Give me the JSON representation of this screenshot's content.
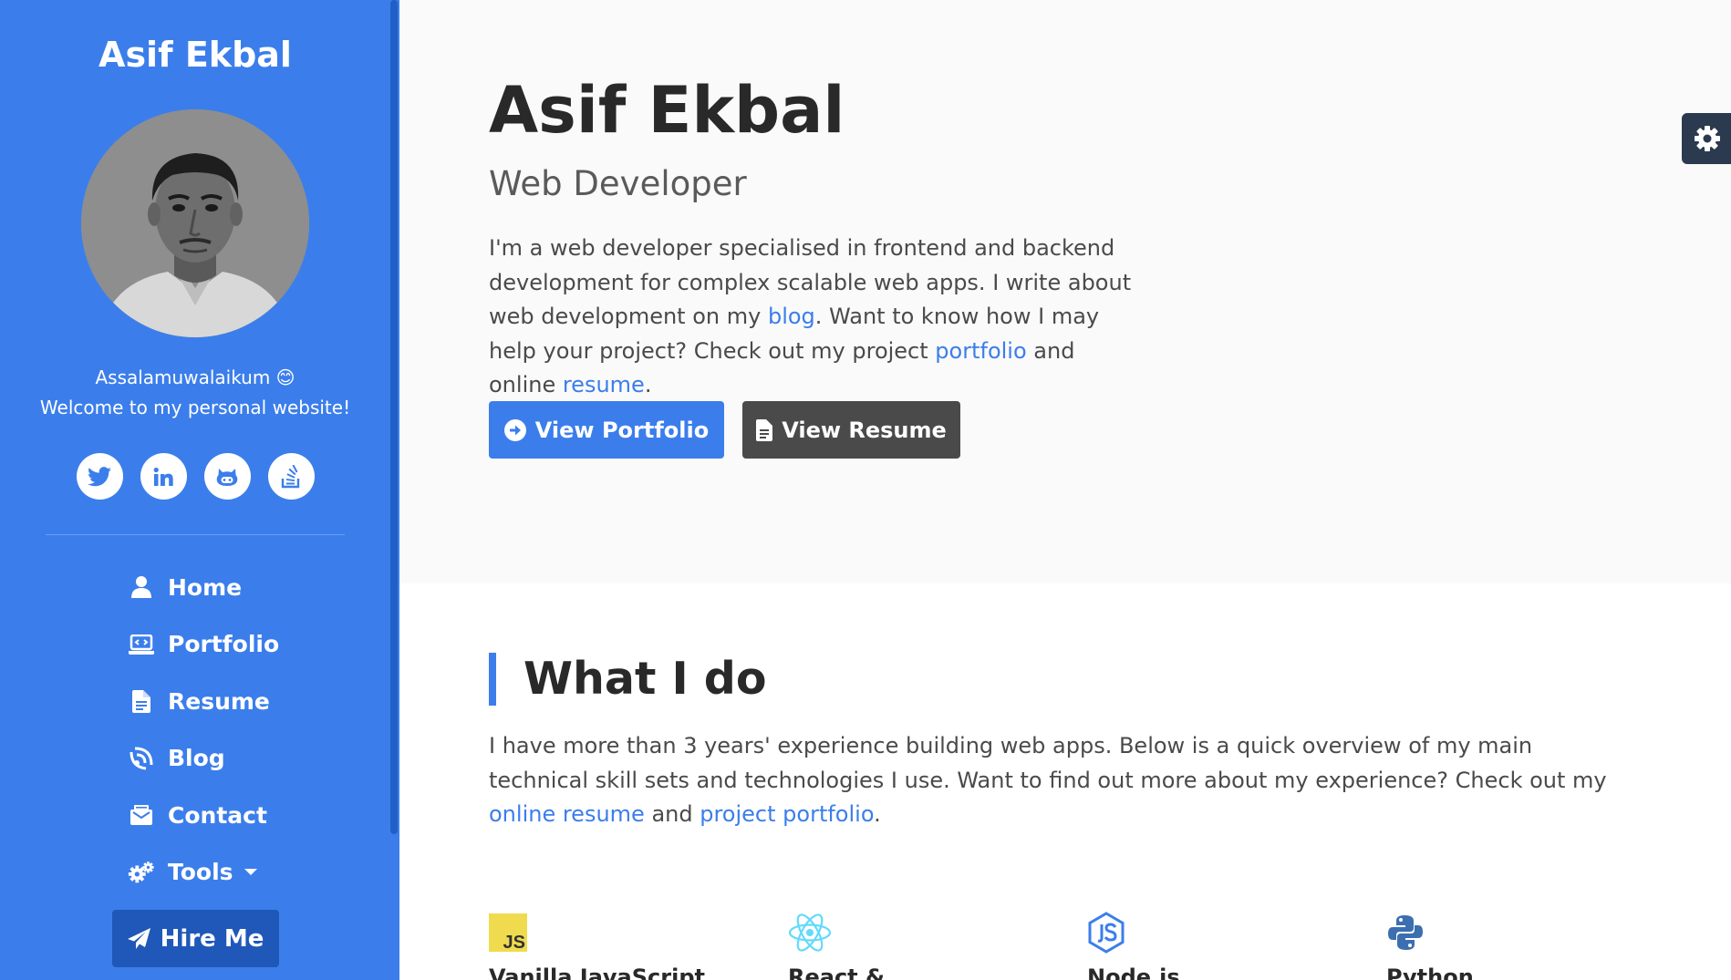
{
  "sidebar": {
    "brand": "Asif Ekbal",
    "greeting_line1": "Assalamuwalaikum 😊",
    "greeting_line2": "Welcome to my personal website!",
    "socials": [
      "twitter-icon",
      "linkedin-icon",
      "github-icon",
      "stackoverflow-icon"
    ],
    "nav": [
      {
        "label": "Home",
        "icon": "user-icon"
      },
      {
        "label": "Portfolio",
        "icon": "laptop-code-icon"
      },
      {
        "label": "Resume",
        "icon": "file-icon"
      },
      {
        "label": "Blog",
        "icon": "blog-icon"
      },
      {
        "label": "Contact",
        "icon": "envelope-icon"
      },
      {
        "label": "Tools",
        "icon": "cogs-icon"
      }
    ],
    "hire_label": "Hire Me",
    "accent": "#3b7eeb"
  },
  "hero": {
    "name": "Asif Ekbal",
    "role": "Web Developer",
    "intro_part1": "I'm a web developer specialised in frontend and backend development for complex scalable web apps. I write about web development on my ",
    "intro_link_blog": "blog",
    "intro_part2": ". Want to know how I may help your project? Check out my project ",
    "intro_link_portfolio": "portfolio",
    "intro_part3": " and online ",
    "intro_link_resume": "resume",
    "intro_part4": ".",
    "btn_portfolio": "View Portfolio",
    "btn_resume": "View Resume"
  },
  "section": {
    "title": "What I do",
    "text_part1": "I have more than 3 years' experience building web apps. Below is a quick overview of my main technical skill sets and technologies I use. Want to find out more about my experience? Check out my ",
    "link_online_resume": "online resume",
    "text_part2": " and ",
    "link_project_portfolio": "project portfolio",
    "text_part3": "."
  },
  "skills": [
    {
      "name": "Vanilla JavaScript",
      "icon": "js-icon"
    },
    {
      "name": "React &",
      "icon": "react-icon"
    },
    {
      "name": "Node.js",
      "icon": "nodejs-icon"
    },
    {
      "name": "Python",
      "icon": "python-icon"
    }
  ]
}
